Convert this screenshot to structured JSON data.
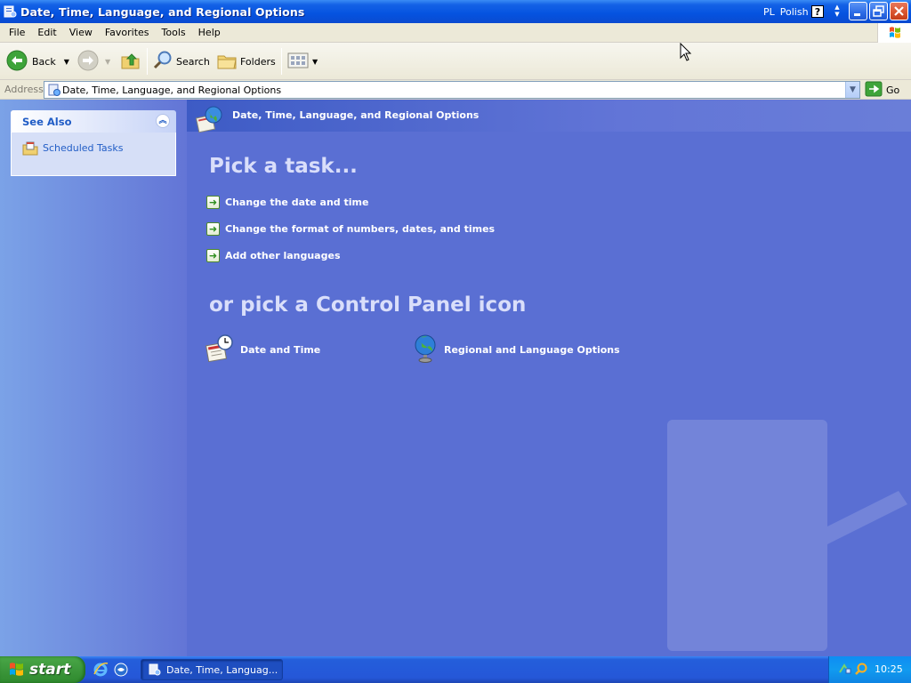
{
  "window": {
    "title": "Date, Time, Language, and Regional Options"
  },
  "language_bar": {
    "code": "PL",
    "name": "Polish",
    "help": "?"
  },
  "menubar": {
    "items": [
      "File",
      "Edit",
      "View",
      "Favorites",
      "Tools",
      "Help"
    ]
  },
  "toolbar": {
    "back_label": "Back",
    "search_label": "Search",
    "folders_label": "Folders"
  },
  "address": {
    "label": "Address",
    "value": "Date, Time, Language, and Regional Options",
    "go_label": "Go"
  },
  "see_also": {
    "title": "See Also",
    "items": [
      {
        "label": "Scheduled Tasks",
        "icon": "scheduled-tasks-icon"
      }
    ]
  },
  "main": {
    "header_title": "Date, Time, Language, and Regional Options",
    "pick_task_heading": "Pick a task...",
    "tasks": [
      {
        "label": "Change the date and time"
      },
      {
        "label": "Change the format of numbers, dates, and times"
      },
      {
        "label": "Add other languages"
      }
    ],
    "pick_icon_heading": "or pick a Control Panel icon",
    "icons": [
      {
        "label": "Date and Time",
        "icon": "date-time-icon"
      },
      {
        "label": "Regional and Language Options",
        "icon": "globe-icon"
      }
    ]
  },
  "taskbar": {
    "start_label": "start",
    "task_item_label": "Date, Time, Languag...",
    "clock": "10:25"
  },
  "colors": {
    "title_bar": "#0553e0",
    "main_background": "#5a6fd3",
    "start_green": "#3c973b",
    "link_blue": "#215dc6"
  }
}
